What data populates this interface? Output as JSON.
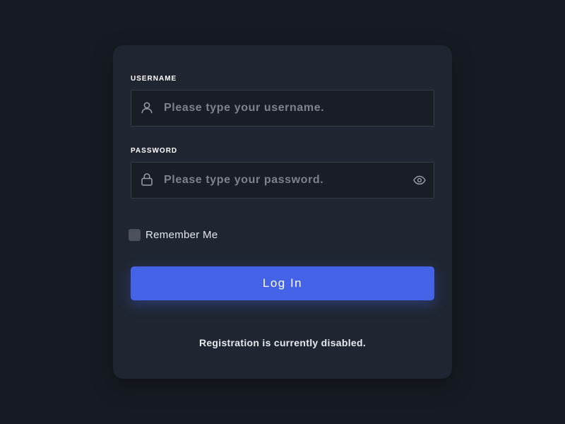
{
  "login_form": {
    "username": {
      "label": "USERNAME",
      "placeholder": "Please type your username.",
      "value": "",
      "icon": "user-icon"
    },
    "password": {
      "label": "PASSWORD",
      "placeholder": "Please type your password.",
      "value": "",
      "icon": "lock-icon",
      "toggle_icon": "eye-icon"
    },
    "remember_me": {
      "label": "Remember Me",
      "checked": false
    },
    "submit_label": "Log In",
    "registration_note": "Registration is currently disabled."
  },
  "colors": {
    "page_background": "#161b23",
    "card_background": "#1f2632",
    "input_background": "#181d26",
    "input_border": "#363d49",
    "accent": "#4563e6",
    "checkbox": "#4b505c",
    "placeholder_text": "#7d838c",
    "text": "#ffffff"
  }
}
